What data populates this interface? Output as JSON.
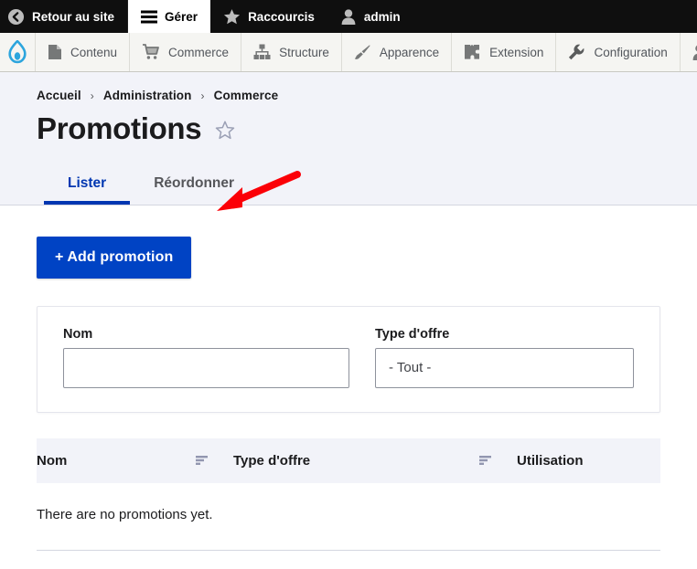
{
  "toolbar": {
    "items": [
      {
        "label": "Retour au site",
        "icon": "back-circle-icon",
        "active": false
      },
      {
        "label": "Gérer",
        "icon": "hamburger-icon",
        "active": true
      },
      {
        "label": "Raccourcis",
        "icon": "star-icon",
        "active": false
      },
      {
        "label": "admin",
        "icon": "user-icon",
        "active": false
      }
    ]
  },
  "admin_menu": {
    "logo": "drupal-droplet-icon",
    "items": [
      {
        "label": "Contenu",
        "icon": "document-icon"
      },
      {
        "label": "Commerce",
        "icon": "shopping-cart-icon"
      },
      {
        "label": "Structure",
        "icon": "sitemap-icon"
      },
      {
        "label": "Apparence",
        "icon": "paintbrush-icon"
      },
      {
        "label": "Extension",
        "icon": "puzzle-piece-icon"
      },
      {
        "label": "Configuration",
        "icon": "wrench-icon"
      },
      {
        "label": "",
        "icon": "people-icon"
      }
    ]
  },
  "header": {
    "breadcrumb": [
      {
        "label": "Accueil"
      },
      {
        "label": "Administration"
      },
      {
        "label": "Commerce"
      }
    ],
    "breadcrumb_separator": "›",
    "title": "Promotions",
    "star_icon": "star-outline-icon",
    "tabs": [
      {
        "label": "Lister",
        "active": true
      },
      {
        "label": "Réordonner",
        "active": false
      }
    ]
  },
  "main": {
    "add_button_label": "+ Add promotion",
    "annotation": {
      "type": "arrow",
      "color": "#fb0007"
    },
    "filters": {
      "name": {
        "label": "Nom",
        "value": "",
        "placeholder": ""
      },
      "offer_type": {
        "label": "Type d'offre",
        "selected": "- Tout -"
      }
    },
    "table": {
      "columns": [
        {
          "label": "Nom",
          "sortable": true,
          "sort_icon": "sort-icon"
        },
        {
          "label": "Type d'offre",
          "sortable": true,
          "sort_icon": "sort-icon"
        },
        {
          "label": "Utilisation",
          "sortable": false
        }
      ],
      "rows": [],
      "empty_message": "There are no promotions yet."
    }
  },
  "colors": {
    "toolbar_bg": "#0f0f0f",
    "admin_menu_bg": "#f5f5f2",
    "header_bg": "#f2f3f9",
    "primary": "#0043c4",
    "tab_active": "#0036b1",
    "annotation_red": "#fb0007",
    "drupal_blue": "#2ca5dd"
  }
}
